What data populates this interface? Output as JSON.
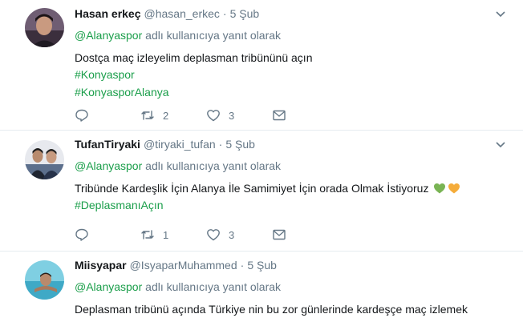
{
  "reply_prefix": "adlı kullanıcıya yanıt olarak",
  "tweets": [
    {
      "fullname": "Hasan erkeç",
      "username": "@hasan_erkec",
      "dot": "·",
      "time": "5 Şub",
      "reply_to": "@Alanyaspor",
      "text_lines": [
        "Dostça maç izleyelim deplasman tribününü açın"
      ],
      "hashtags": [
        "#Konyaspor",
        "#KonyasporAlanya"
      ],
      "retweets": "2",
      "likes": "3"
    },
    {
      "fullname": "TufanTiryaki",
      "username": "@tiryaki_tufan",
      "dot": "·",
      "time": "5 Şub",
      "reply_to": "@Alanyaspor",
      "text_lines": [
        "Tribünde Kardeşlik İçin Alanya İle Samimiyet İçin orada Olmak İstiyoruz"
      ],
      "emojis": [
        "green-heart",
        "yellow-heart"
      ],
      "hashtags": [
        "#DeplasmanıAçın"
      ],
      "retweets": "1",
      "likes": "3"
    },
    {
      "fullname": "Miisyapar",
      "username": "@IsyaparMuhammed",
      "dot": "·",
      "time": "5 Şub",
      "reply_to": "@Alanyaspor",
      "text_lines": [
        "Deplasman tribünü açında Türkiye nin bu zor günlerinde kardeşçe maç izlemek"
      ]
    }
  ],
  "colors": {
    "accent": "#1a9e4a",
    "muted": "#657786",
    "border": "#e6ecf0"
  }
}
